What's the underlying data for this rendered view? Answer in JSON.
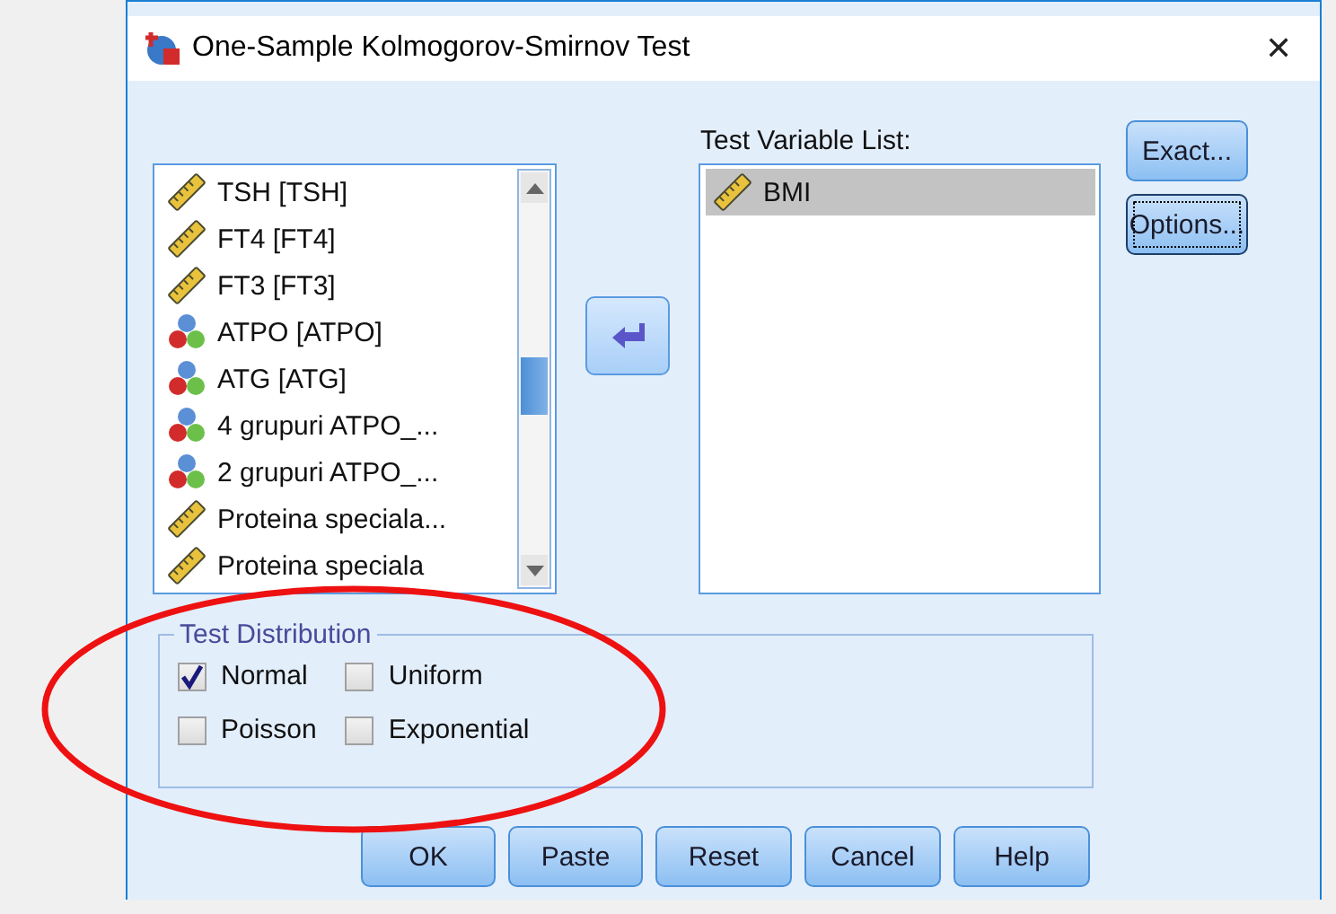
{
  "window": {
    "title": "One-Sample Kolmogorov-Smirnov Test",
    "close": "✕"
  },
  "source_list": {
    "items": [
      {
        "label": "TSH  [TSH]",
        "kind": "scale",
        "selected": false
      },
      {
        "label": "FT4  [FT4]",
        "kind": "scale",
        "selected": false
      },
      {
        "label": "FT3 [FT3]",
        "kind": "scale",
        "selected": false
      },
      {
        "label": "ATPO [ATPO]",
        "kind": "nominal",
        "selected": false
      },
      {
        "label": "ATG [ATG]",
        "kind": "nominal",
        "selected": false
      },
      {
        "label": "4 grupuri ATPO_...",
        "kind": "nominal",
        "selected": false
      },
      {
        "label": "2 grupuri ATPO_...",
        "kind": "nominal",
        "selected": false
      },
      {
        "label": "Proteina speciala...",
        "kind": "scale",
        "selected": false
      },
      {
        "label": "Proteina speciala",
        "kind": "scale",
        "selected": false
      }
    ]
  },
  "test_variable_list": {
    "label": "Test Variable List:",
    "items": [
      {
        "label": "BMI",
        "kind": "scale",
        "selected": true
      }
    ]
  },
  "side_buttons": [
    {
      "label": "Exact...",
      "focused": false
    },
    {
      "label": "Options...",
      "focused": true
    }
  ],
  "test_distribution": {
    "legend": "Test Distribution",
    "options": [
      {
        "label": "Normal",
        "checked": true
      },
      {
        "label": "Uniform",
        "checked": false
      },
      {
        "label": "Poisson",
        "checked": false
      },
      {
        "label": "Exponential",
        "checked": false
      }
    ]
  },
  "buttons": [
    "OK",
    "Paste",
    "Reset",
    "Cancel",
    "Help"
  ]
}
